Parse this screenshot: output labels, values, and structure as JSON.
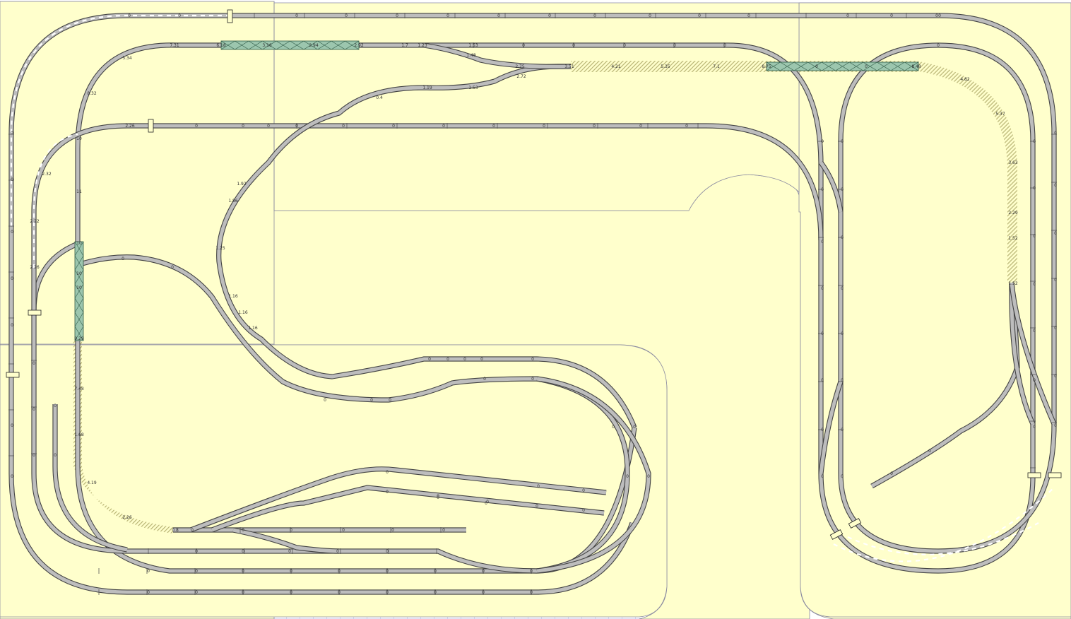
{
  "colors": {
    "baseboard": "#FFFFCC",
    "baseboard_edge": "#8a8aa0",
    "grid_line": "#9da4dc",
    "rail_outer": "#444444",
    "rail_fill": "#BDBDBD",
    "bridge": "#9CC6AE",
    "bridge_edge": "#2f5a45",
    "ballast_hatch": "#B8B474",
    "white_dash": "#FFFFFF"
  },
  "track_labels": {
    "upper_siding": [
      "7.31",
      "6.18",
      "3.16",
      "2.94",
      "2.92",
      "1.7",
      "1.23",
      "1.53"
    ],
    "upper_siding_inner": [
      "1.48",
      "2.75",
      "2.72",
      "3.51",
      "4.21",
      "5.35",
      "7.1",
      "8.75",
      "8.48"
    ],
    "inner_climb": [
      "0.4",
      "1.19",
      "1.53",
      "1.92",
      "1.86",
      "1.25",
      "1.16",
      "1.16",
      "1.16"
    ],
    "left_inner": [
      "5.34",
      "8.32",
      "11",
      "2.26",
      "2.32",
      "10"
    ],
    "left_outer": [
      "2.22",
      "2.26",
      "2.26"
    ],
    "left_bridge": [
      "10",
      "10",
      "10",
      "9.29",
      "7.48",
      "1.68",
      "4.19",
      "2.26",
      "0.8"
    ],
    "right_loop": [
      "4.82",
      "5.37",
      "3.63",
      "2.29",
      "1.52",
      "1.52"
    ],
    "zero": "0"
  }
}
